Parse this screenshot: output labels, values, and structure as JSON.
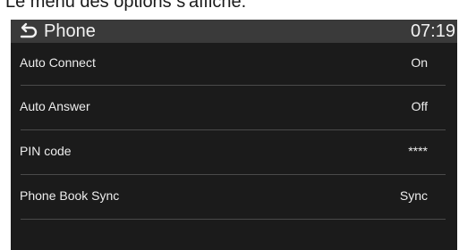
{
  "caption": "Le menu des options s'affiche.",
  "header": {
    "back_icon": "back-arrow-icon",
    "title": "Phone",
    "clock": "07:19"
  },
  "settings": [
    {
      "label": "Auto Connect",
      "value": "On"
    },
    {
      "label": "Auto Answer",
      "value": "Off"
    },
    {
      "label": "PIN code",
      "value": "****"
    },
    {
      "label": "Phone Book Sync",
      "value": "Sync"
    }
  ],
  "colors": {
    "screen_background": "#1b1b1b",
    "titlebar_background": "#3a3a3a",
    "text": "#ededed",
    "divider": "#4a4a4a"
  }
}
